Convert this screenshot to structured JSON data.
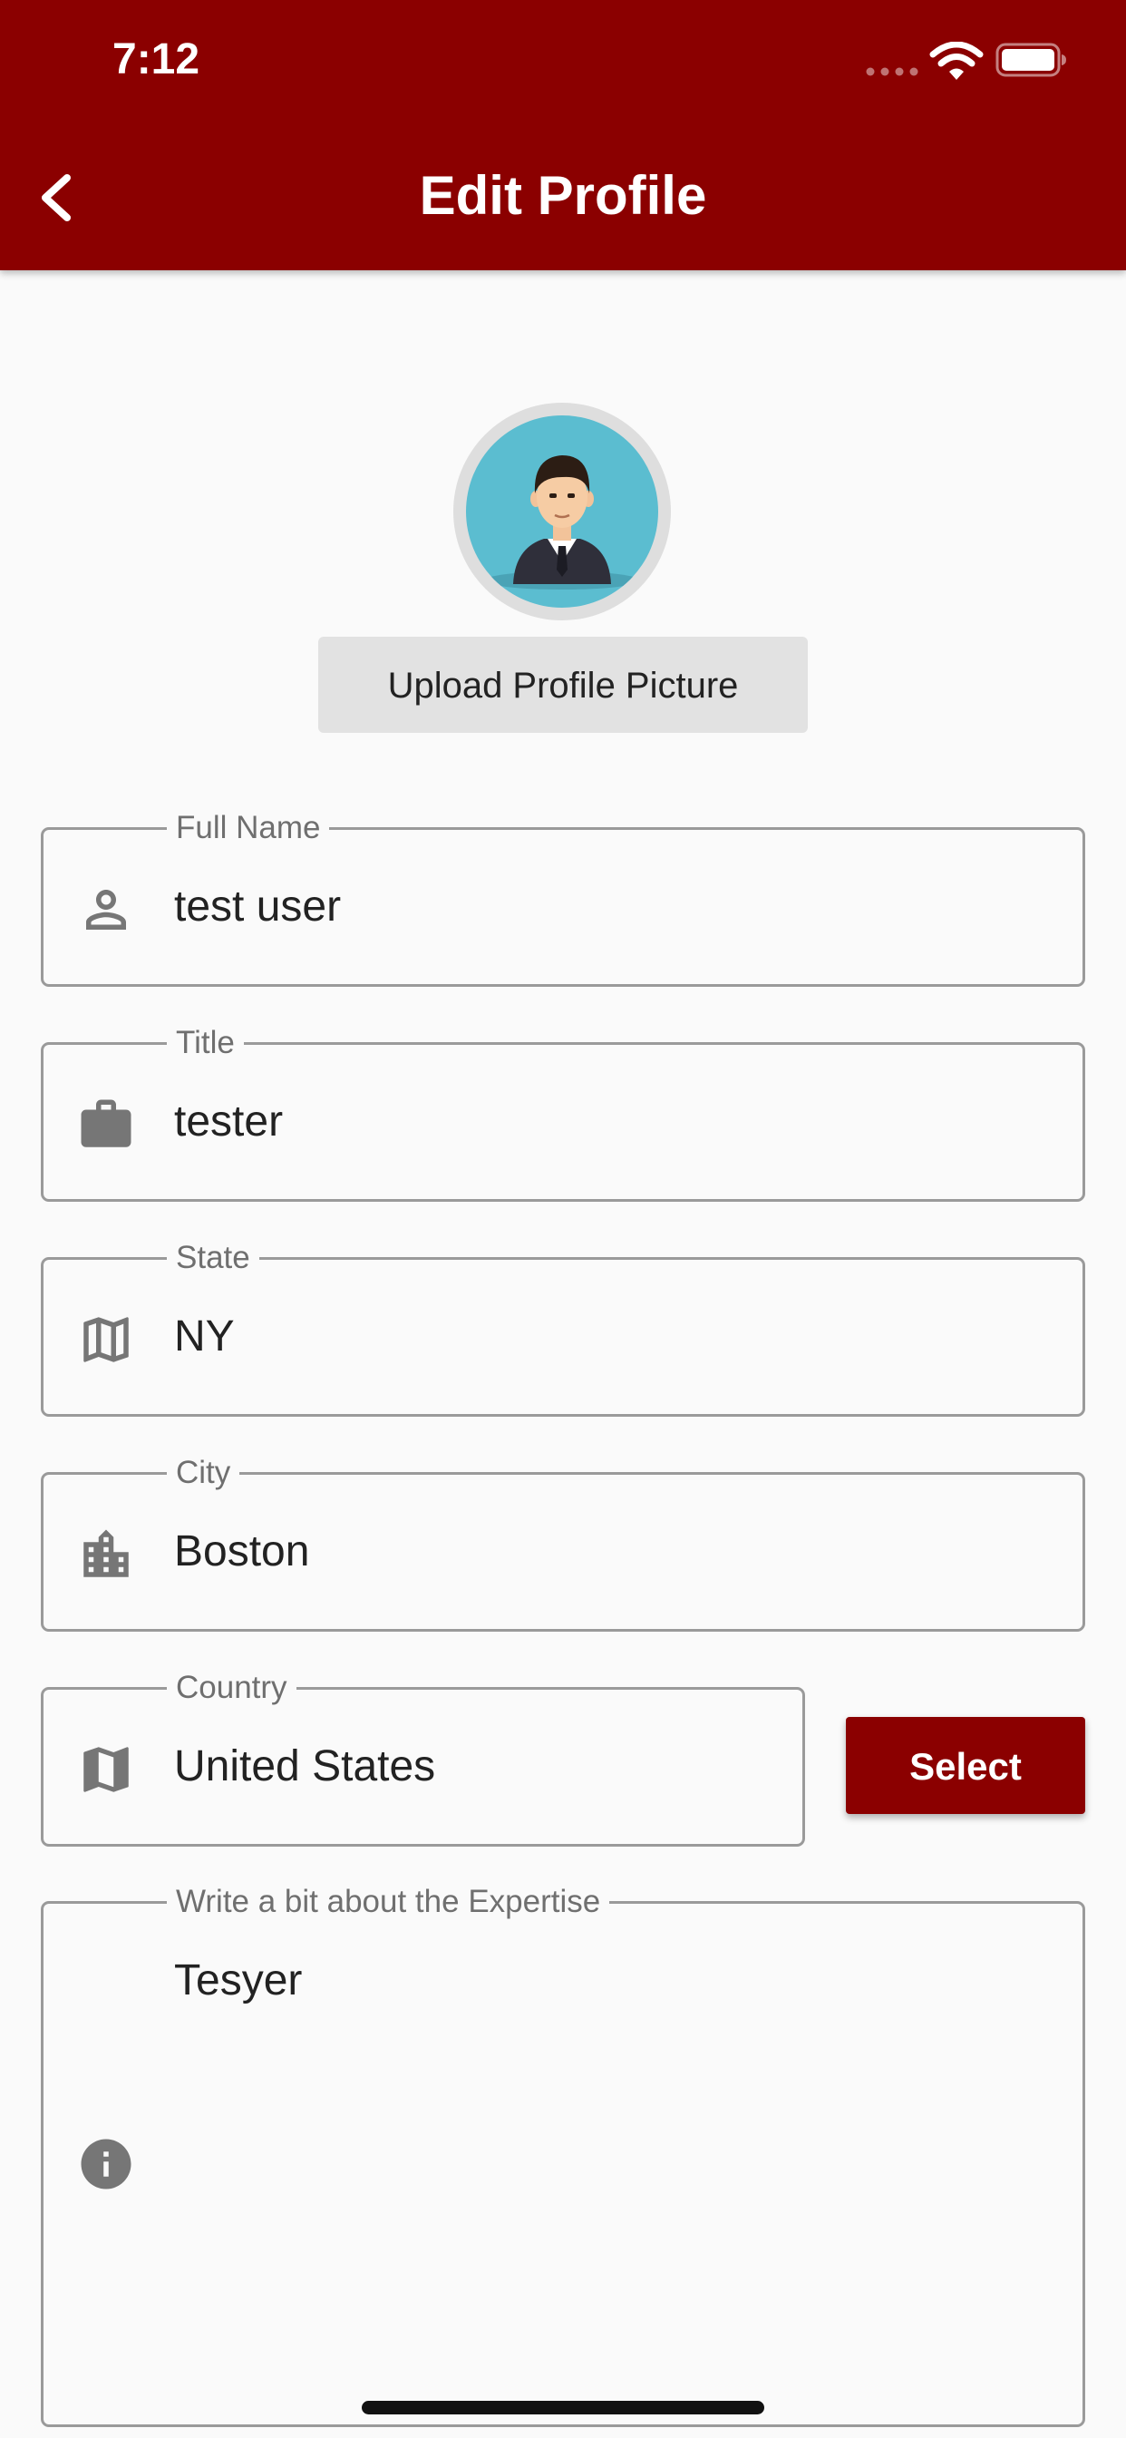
{
  "status_bar": {
    "time": "7:12",
    "signal_icon": "signal-dots-icon",
    "wifi_icon": "wifi-icon",
    "battery_icon": "battery-icon"
  },
  "header": {
    "title": "Edit Profile",
    "back_icon": "chevron-left-icon",
    "background_color": "#8b0000"
  },
  "profile_picture": {
    "avatar_icon": "businessman-avatar",
    "upload_label": "Upload Profile Picture"
  },
  "form": {
    "full_name": {
      "label": "Full Name",
      "value": "test user",
      "icon": "person-icon"
    },
    "title": {
      "label": "Title",
      "value": "tester",
      "icon": "briefcase-icon"
    },
    "state": {
      "label": "State",
      "value": "NY",
      "icon": "map-icon"
    },
    "city": {
      "label": "City",
      "value": "Boston",
      "icon": "city-icon"
    },
    "country": {
      "label": "Country",
      "value": "United States",
      "icon": "map-filled-icon",
      "select_label": "Select"
    },
    "expertise": {
      "label": "Write a bit about the Expertise",
      "value": "Tesyer",
      "icon": "info-icon"
    }
  },
  "colors": {
    "accent": "#8b0000",
    "field_border": "#9a9a9a",
    "icon": "#767676"
  }
}
